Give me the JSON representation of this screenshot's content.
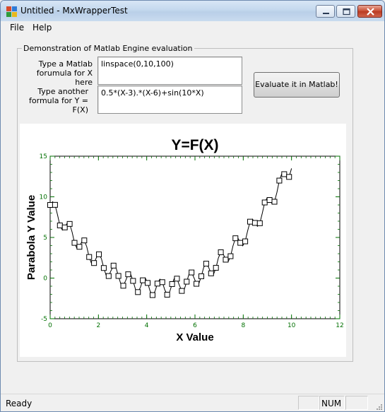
{
  "window": {
    "title": "Untitled - MxWrapperTest"
  },
  "menu": {
    "file": "File",
    "help": "Help"
  },
  "group": {
    "label": "Demonstration of Matlab Engine evaluation"
  },
  "form": {
    "x_label_line1": "Type a Matlab",
    "x_label_line2": "forumula for X here",
    "x_value": "linspace(0,10,100)",
    "y_label_line1": "Type another",
    "y_label_line2": "formula for Y = F(X)",
    "y_value": "0.5*(X-3).*(X-6)+sin(10*X)",
    "evaluate_label": "Evaluate it in Matlab!"
  },
  "status": {
    "text": "Ready",
    "num": "NUM"
  },
  "colors": {
    "axis_tick": "#007000",
    "marker": "#000000"
  },
  "chart_data": {
    "type": "line",
    "title": "Y=F(X)",
    "xlabel": "X Value",
    "ylabel": "Parabola Y Value",
    "xlim": [
      0,
      12
    ],
    "ylim": [
      -5,
      15
    ],
    "xticks": [
      "0",
      "2",
      "4",
      "6",
      "8",
      "10",
      "12"
    ],
    "yticks": [
      "-5",
      "0",
      "5",
      "10",
      "15"
    ],
    "grid": false,
    "marker": "square",
    "x_formula": "linspace(0,10,100)",
    "y_formula": "0.5*(X-3).*(X-6)+sin(10*X)",
    "marker_every": 2
  }
}
